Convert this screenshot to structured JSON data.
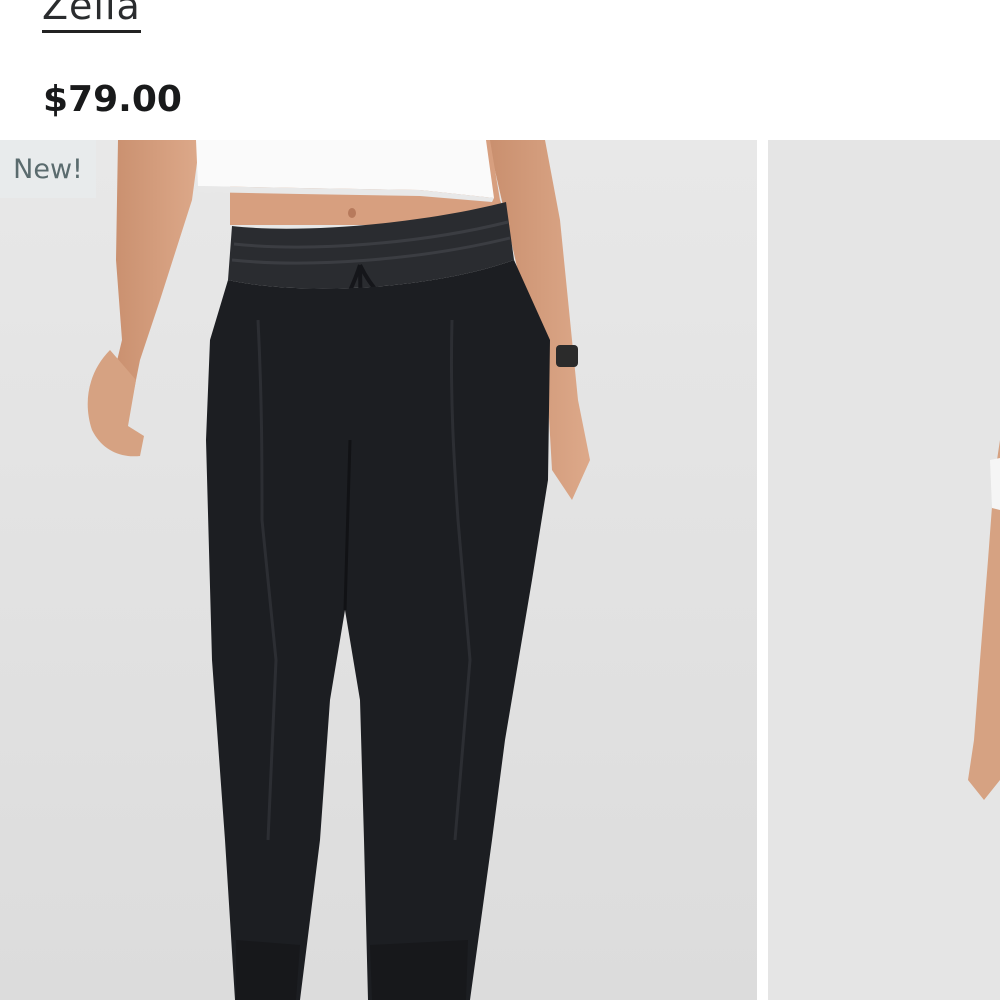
{
  "product": {
    "brand": "Zella",
    "price": "$79.00"
  },
  "gallery": {
    "badge": "New!",
    "images": [
      {
        "alt": "Model wearing black high-waist joggers with drawstring"
      },
      {
        "alt": "Model wearing joggers, alternate view"
      }
    ]
  },
  "colors": {
    "background": "#ffffff",
    "image_bg": "#e4e4e4",
    "pants": "#1c1e22",
    "badge_text": "#5a6b6e"
  }
}
